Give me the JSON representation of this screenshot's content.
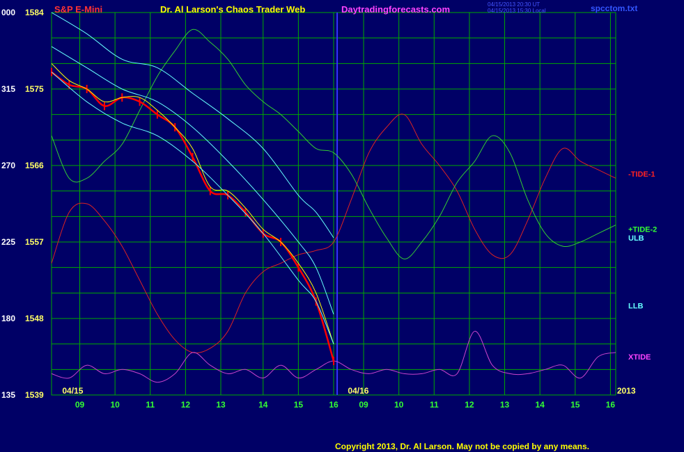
{
  "header": {
    "symbol": "S&P E-Mini",
    "title": "Dr. Al Larson's Chaos Trader Web",
    "site": "Daytradingforecasts.com",
    "timestamp1": "04/15/2013 20:30 UT",
    "timestamp2": "04/15/2013 15:30 Local",
    "filename": "spcctom.txt"
  },
  "footer": {
    "copyright": "Copyright 2013, Dr. Al Larson. May not be copied by any means."
  },
  "colors": {
    "background": "#000066",
    "grid": "#00aa00",
    "price": "#ff0000",
    "average": "#ffff00",
    "band": "#66ffff",
    "tide1": "#dd2222",
    "tide2": "#33cc33",
    "xtide": "#cc44cc",
    "separator": "#3333ff"
  },
  "chart_data": {
    "type": "line",
    "x_range": [
      0,
      16
    ],
    "y_range": [
      135,
      1584
    ],
    "left_axis_labels": [
      {
        "left": "000",
        "price": "1584",
        "value": 1584
      },
      {
        "left": "315",
        "price": "1575",
        "value": 1575
      },
      {
        "left": "270",
        "price": "1566",
        "value": 1566
      },
      {
        "left": "225",
        "price": "1557",
        "value": 1557
      },
      {
        "left": "180",
        "price": "1548",
        "value": 1548
      },
      {
        "left": "135",
        "price": "1539",
        "value": 1539
      }
    ],
    "x_ticks": [
      {
        "label": "09",
        "x": 0.8
      },
      {
        "label": "10",
        "x": 1.8
      },
      {
        "label": "11",
        "x": 2.8
      },
      {
        "label": "12",
        "x": 3.8
      },
      {
        "label": "13",
        "x": 4.8
      },
      {
        "label": "14",
        "x": 6.0
      },
      {
        "label": "15",
        "x": 7.0
      },
      {
        "label": "16",
        "x": 8.0
      },
      {
        "label": "09",
        "x": 8.85
      },
      {
        "label": "10",
        "x": 9.85
      },
      {
        "label": "11",
        "x": 10.85
      },
      {
        "label": "12",
        "x": 11.85
      },
      {
        "label": "13",
        "x": 12.85
      },
      {
        "label": "14",
        "x": 13.85
      },
      {
        "label": "15",
        "x": 14.85
      },
      {
        "label": "16",
        "x": 15.85
      }
    ],
    "date_labels": [
      {
        "label": "04/15",
        "x": 0.6
      },
      {
        "label": "04/16",
        "x": 8.7
      },
      {
        "label": "2013",
        "x": 16.3
      }
    ],
    "separator_x": 8.1,
    "series": [
      {
        "name": "-TIDE-1",
        "color": "#dd2222",
        "x": [
          0,
          0.5,
          1,
          1.5,
          2,
          2.5,
          3,
          3.5,
          4,
          4.5,
          5,
          5.5,
          6,
          6.5,
          7,
          7.5,
          8,
          8.5,
          9,
          9.5,
          10,
          10.5,
          11,
          11.5,
          12,
          12.5,
          13,
          13.5,
          14,
          14.5,
          15,
          15.5,
          16
        ],
        "y": [
          1554.5,
          1560.5,
          1561.5,
          1559.5,
          1556.5,
          1552.5,
          1548.5,
          1545.5,
          1544,
          1544.5,
          1546.5,
          1551,
          1553.5,
          1554.5,
          1555.5,
          1556,
          1557,
          1562,
          1567.5,
          1570.5,
          1572,
          1568.5,
          1566,
          1563,
          1558.5,
          1555.5,
          1555.5,
          1559.5,
          1564.5,
          1568,
          1566.5,
          1565.5,
          1564.5
        ]
      },
      {
        "name": "+TIDE-2",
        "color": "#33cc33",
        "x": [
          0,
          0.5,
          1,
          1.5,
          2,
          2.5,
          3,
          3.5,
          4,
          4.5,
          5,
          5.5,
          6,
          6.5,
          7,
          7.5,
          8,
          8.5,
          9,
          9.5,
          10,
          10.5,
          11,
          11.5,
          12,
          12.5,
          13,
          13.5,
          14,
          14.5,
          15,
          15.5,
          16
        ],
        "y": [
          1569.5,
          1564.5,
          1564.5,
          1566.5,
          1568.5,
          1572.5,
          1576.5,
          1579.5,
          1582,
          1580.5,
          1578.5,
          1575.5,
          1573.5,
          1572,
          1570,
          1568,
          1567.5,
          1565,
          1561,
          1557.5,
          1555,
          1557,
          1560,
          1564,
          1566.5,
          1569.5,
          1567.5,
          1562,
          1558,
          1556.5,
          1557,
          1558,
          1559
        ]
      },
      {
        "name": "XTIDE",
        "color": "#cc44cc",
        "x": [
          0,
          0.5,
          1,
          1.5,
          2,
          2.5,
          3,
          3.5,
          4,
          4.5,
          5,
          5.5,
          6,
          6.5,
          7,
          7.5,
          8,
          8.5,
          9,
          9.5,
          10,
          10.5,
          11,
          11.5,
          12,
          12.5,
          13,
          13.5,
          14,
          14.5,
          15,
          15.5,
          16
        ],
        "y": [
          1541.5,
          1541,
          1542.5,
          1541.5,
          1542,
          1541.5,
          1540.5,
          1541.5,
          1544,
          1542.5,
          1541.5,
          1542,
          1541,
          1542.5,
          1541,
          1542,
          1543,
          1542,
          1541.5,
          1542,
          1541.5,
          1541.5,
          1542,
          1541.5,
          1546.5,
          1542.5,
          1541.5,
          1541.5,
          1542,
          1542.5,
          1541,
          1543.5,
          1544
        ]
      },
      {
        "name": "Price",
        "color": "#ff0000",
        "x": [
          0,
          0.5,
          1,
          1.5,
          2,
          2.5,
          3,
          3.5,
          4,
          4.5,
          5,
          5.5,
          6,
          6.5,
          7,
          7.5,
          8
        ],
        "y": [
          1577,
          1575.5,
          1575,
          1573,
          1574,
          1573.5,
          1572,
          1570.5,
          1567,
          1563,
          1562.5,
          1560.5,
          1558,
          1557,
          1554,
          1550,
          1543
        ]
      },
      {
        "name": "Average",
        "color": "#ffff00",
        "x": [
          0,
          0.5,
          1,
          1.5,
          2,
          2.5,
          3,
          3.5,
          4,
          4.5,
          5,
          5.5,
          6,
          6.5,
          7,
          7.5,
          8
        ],
        "y": [
          1578,
          1576,
          1575,
          1573.5,
          1574,
          1574,
          1572.5,
          1570.5,
          1568,
          1563.5,
          1563,
          1561,
          1558.5,
          1557,
          1554.5,
          1551,
          1545
        ]
      },
      {
        "name": "Upper band",
        "color": "#66ffff",
        "x": [
          0,
          1,
          2,
          3,
          4,
          5,
          6,
          7,
          7.5,
          8
        ],
        "y": [
          1584,
          1581.5,
          1578.5,
          1577.5,
          1574.5,
          1571.5,
          1568,
          1562.5,
          1560.5,
          1557.5
        ]
      },
      {
        "name": "Middle band",
        "color": "#66ffff",
        "x": [
          0,
          1,
          2,
          3,
          4,
          5,
          6,
          7,
          7.5,
          8
        ],
        "y": [
          1580,
          1577.5,
          1575,
          1573.5,
          1570.5,
          1566.5,
          1562,
          1557,
          1554,
          1548.5
        ]
      },
      {
        "name": "Lower band",
        "color": "#66ffff",
        "x": [
          0,
          1,
          2,
          3,
          4,
          5,
          6,
          7,
          7.5,
          8
        ],
        "y": [
          1577,
          1573.5,
          1571,
          1569.5,
          1566.5,
          1562.5,
          1558,
          1552.5,
          1550,
          1545
        ]
      }
    ],
    "right_labels": [
      {
        "text": "-TIDE-1",
        "value": 1565,
        "color": "#ff2222"
      },
      {
        "text": "+TIDE-2",
        "value": 1558.5,
        "color": "#33ff33"
      },
      {
        "text": "ULB",
        "value": 1557.5,
        "color": "#66ffff"
      },
      {
        "text": "LLB",
        "value": 1549.5,
        "color": "#66ffff"
      },
      {
        "text": "XTIDE",
        "value": 1543.5,
        "color": "#ff44ff"
      }
    ]
  }
}
